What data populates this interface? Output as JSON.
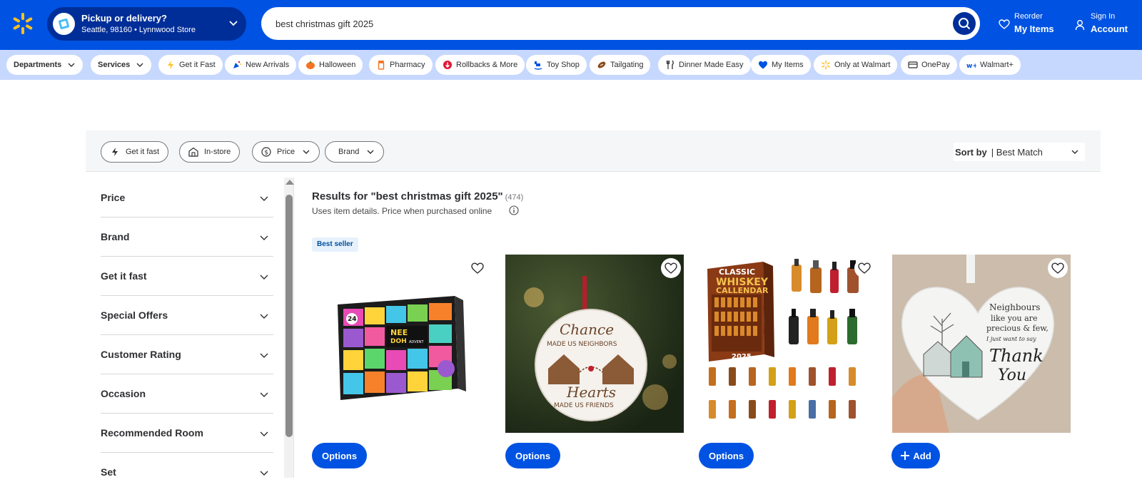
{
  "header": {
    "pickup_title": "Pickup or delivery?",
    "pickup_location": "Seattle, 98160 • Lynnwood Store",
    "search_value": "best christmas gift 2025",
    "reorder_small": "Reorder",
    "reorder_big": "My Items",
    "signin_small": "Sign In",
    "signin_big": "Account"
  },
  "nav": {
    "chips": [
      {
        "label": "Departments"
      },
      {
        "label": "Services"
      },
      {
        "label": "Get it Fast"
      },
      {
        "label": "New Arrivals"
      },
      {
        "label": "Halloween"
      },
      {
        "label": "Pharmacy"
      },
      {
        "label": "Rollbacks & More"
      },
      {
        "label": "Toy Shop"
      },
      {
        "label": "Tailgating"
      },
      {
        "label": "Dinner Made Easy"
      },
      {
        "label": "My Items"
      },
      {
        "label": "Only at Walmart"
      },
      {
        "label": "OnePay"
      },
      {
        "label": "Walmart+"
      }
    ]
  },
  "filters": {
    "pills": [
      "Get it fast",
      "In-store",
      "Price",
      "Brand"
    ],
    "sort_label": "Sort by",
    "sort_value": "| Best Match"
  },
  "facets": [
    "Price",
    "Brand",
    "Get it fast",
    "Special Offers",
    "Customer Rating",
    "Occasion",
    "Recommended Room",
    "Set"
  ],
  "results": {
    "title": "Results for \"best christmas gift 2025\"",
    "count": "(474)",
    "subtitle": "Uses item details. Price when purchased online",
    "badge": "Best seller"
  },
  "products": [
    {
      "image_text_1": "24",
      "image_text_2": "NEE",
      "image_text_3": "DOH",
      "image_text_4": "ADVENT",
      "button": "Options"
    },
    {
      "image_text_1": "Chance",
      "image_text_2": "MADE US NEIGHBORS",
      "image_text_3": "Hearts",
      "image_text_4": "MADE US FRIENDS",
      "button": "Options"
    },
    {
      "image_text_1": "CLASSIC",
      "image_text_2": "WHISKEY",
      "image_text_3": "CALLENDAR",
      "image_text_4": "2025",
      "button": "Options"
    },
    {
      "image_text_1": "Neighbours",
      "image_text_2": "like you are",
      "image_text_3": "precious & few,",
      "image_text_4": "I just want to say",
      "image_text_5": "Thank",
      "image_text_6": "You",
      "button": "Add"
    }
  ],
  "colors": {
    "brand_blue": "#0053e2",
    "dark_blue": "#002e99",
    "spark_yellow": "#ffc220",
    "nav_bg": "#c7d8ff"
  }
}
